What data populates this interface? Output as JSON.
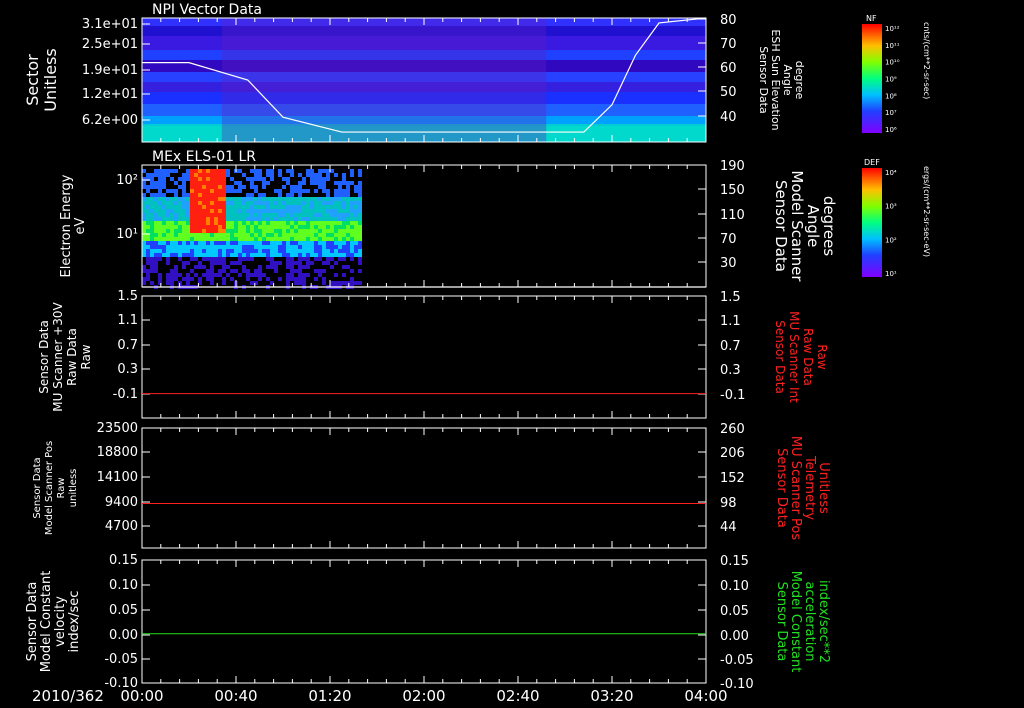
{
  "colors": {
    "white": "#ffffff",
    "red": "#ff2020",
    "green": "#20e020",
    "bg": "#000000"
  },
  "time_axis": {
    "date_label": "2010/362",
    "tick_labels": [
      "00:00",
      "00:40",
      "01:20",
      "02:00",
      "02:40",
      "03:20",
      "04:00"
    ]
  },
  "colorbars": [
    {
      "label": "NF",
      "unit_label": "cnts/(cm**2-sr-sec)",
      "tick_labels": [
        "10¹²",
        "10¹¹",
        "10¹⁰",
        "10⁹",
        "10⁸",
        "10⁷",
        "10⁶"
      ]
    },
    {
      "label": "DEF",
      "unit_label": "ergs/(cm**2-sr-sec-eV)",
      "tick_labels": [
        "10⁴",
        "10³",
        "10²",
        "10¹"
      ]
    }
  ],
  "chart_data": [
    {
      "type": "heatmap",
      "title": "NPI Vector Data",
      "ylabel": [
        "Sector",
        "Unitless"
      ],
      "ytick_labels": [
        "3.1e+01",
        "2.5e+01",
        "1.9e+01",
        "1.2e+01",
        "6.2e+00"
      ],
      "right_ylabel": [
        "Sensor Data",
        "ESH Sun Elevation",
        "Angle",
        "degree"
      ],
      "right_ytick_labels": [
        "80",
        "70",
        "60",
        "50",
        "40"
      ],
      "right_ylim": [
        30,
        80
      ],
      "overlay_line": {
        "x": [
          0,
          20,
          45,
          60,
          85,
          112,
          188,
          200,
          210,
          220,
          240
        ],
        "y": [
          62,
          62,
          55,
          40,
          34,
          34,
          34,
          45,
          65,
          78,
          80
        ]
      }
    },
    {
      "type": "heatmap",
      "title": "MEx ELS-01 LR",
      "ylabel": [
        "Electron Energy",
        "eV"
      ],
      "ytick_labels": [
        "10²",
        "10¹"
      ],
      "right_ylabel": [
        "Sensor Data",
        "Model Scanner",
        "Angle",
        "degrees"
      ],
      "right_ytick_labels": [
        "190",
        "150",
        "110",
        "70",
        "30"
      ],
      "right_ylim": [
        10,
        190
      ],
      "overlay_line": {
        "x": [
          0,
          240
        ],
        "y": [
          10,
          10
        ]
      }
    },
    {
      "type": "line",
      "ylabel": [
        "Sensor Data",
        "MU Scanner +30V",
        "Raw Data",
        "Raw"
      ],
      "ytick_labels": [
        "1.5",
        "1.1",
        "0.7",
        "0.3",
        "-0.1"
      ],
      "right_ylabel": [
        "Sensor Data",
        "MU Scanner Int",
        "Raw Data",
        "Raw"
      ],
      "right_ytick_labels": [
        "1.5",
        "1.1",
        "0.7",
        "0.3",
        "-0.1"
      ],
      "ylim": [
        -0.5,
        1.5
      ],
      "series": [
        {
          "x": [
            0,
            240
          ],
          "y": [
            -0.1,
            -0.1
          ]
        }
      ]
    },
    {
      "type": "line",
      "ylabel": [
        "Sensor Data",
        "Model Scanner Pos",
        "Raw",
        "unitless"
      ],
      "ytick_labels": [
        "23500",
        "18800",
        "14100",
        "9400",
        "4700"
      ],
      "right_ylabel": [
        "Sensor Data",
        "MU Scanner Pos",
        "Telemetry",
        "Unitless"
      ],
      "right_ytick_labels": [
        "260",
        "206",
        "152",
        "98",
        "44"
      ],
      "right_ylim": [
        -10,
        260
      ],
      "series": [
        {
          "x": [
            0,
            240
          ],
          "y": [
            90,
            90
          ]
        }
      ]
    },
    {
      "type": "line",
      "ylabel": [
        "Sensor Data",
        "Model Constant",
        "velocity",
        "index/sec"
      ],
      "ytick_labels": [
        "0.15",
        "0.10",
        "0.05",
        "0.00",
        "-0.05",
        "-0.10"
      ],
      "right_ylabel": [
        "Sensor Data",
        "Model Constant",
        "acceleration",
        "index/sec**2"
      ],
      "right_ytick_labels": [
        "0.15",
        "0.10",
        "0.05",
        "0.00",
        "-0.05",
        "-0.10"
      ],
      "ylim": [
        -0.1,
        0.15
      ],
      "series": [
        {
          "x": [
            0,
            240
          ],
          "y": [
            0.0,
            0.0
          ]
        }
      ]
    }
  ]
}
